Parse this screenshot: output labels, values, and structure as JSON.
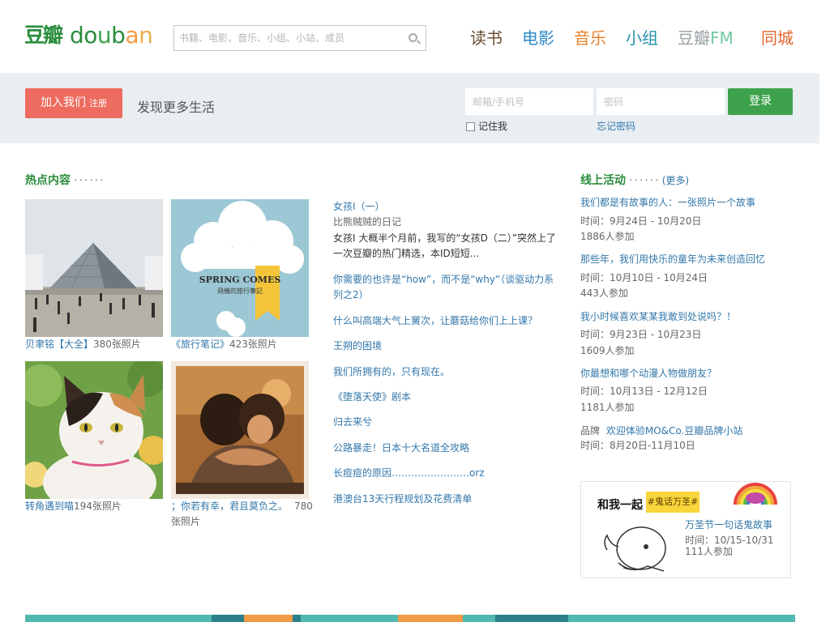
{
  "header": {
    "logo_han": "豆瓣",
    "logo_letters": [
      {
        "ch": "d",
        "color": "#2a8d3c"
      },
      {
        "ch": "o",
        "color": "#2a8d3c"
      },
      {
        "ch": "u",
        "color": "#3da24b"
      },
      {
        "ch": "b",
        "color": "#2a8d3c"
      },
      {
        "ch": "a",
        "color": "#f29b45"
      },
      {
        "ch": "n",
        "color": "#e8b04a"
      }
    ],
    "search_placeholder": "书籍、电影、音乐、小组、小站、成员",
    "channels": [
      {
        "label": "读书",
        "color": "#6a4a2c"
      },
      {
        "label": "电影",
        "color": "#2f8acb"
      },
      {
        "label": "音乐",
        "color": "#e8822e"
      },
      {
        "label": "小组",
        "color": "#2591a8"
      },
      {
        "label_a": "豆瓣",
        "label_b": "FM",
        "color": "#98a0a3",
        "color_b": "#6fcba3"
      },
      {
        "label": "同城",
        "color": "#e2642d"
      }
    ]
  },
  "band": {
    "join_label": "加入我们",
    "join_sub": "注册",
    "slogan": "发现更多生活",
    "email_placeholder": "邮箱/手机号",
    "password_placeholder": "密码",
    "login_label": "登录",
    "remember_label": "记住我",
    "forgot_label": "忘记密码"
  },
  "hot": {
    "title": "热点内容",
    "dots": "······",
    "photos": [
      {
        "title": "贝聿铭【大全】",
        "count": "380张照片"
      },
      {
        "title": "《旅行笔记》",
        "count": "423张照片"
      },
      {
        "title": "转角遇到喵",
        "count": "194张照片"
      },
      {
        "title": "；你若有幸，君且莫负之。",
        "count": "780张照片"
      }
    ],
    "poster_text": "SPRING COMES",
    "poster_sub": "飛機的旅行筆記",
    "articles": [
      {
        "title": "女孩I（一）",
        "sub": "比熊贼贼的日记",
        "desc": "女孩I 大概半个月前，我写的“女孩D（二）”突然上了一次豆瓣的热门精选，本ID短短..."
      },
      {
        "title": "你需要的也许是“how”，而不是“why”（谈驱动力系列之2）"
      },
      {
        "title": "什么叫高端大气上黉次，让蘑菇给你们上上课？"
      },
      {
        "title": "王朔的困境"
      },
      {
        "title": "我们所拥有的，只有现在。"
      },
      {
        "title": "《堕落天使》剧本"
      },
      {
        "title": "归去来兮"
      },
      {
        "title": "公路暴走！日本十大名道全攻略"
      },
      {
        "title": "长痘痘的原因……………………orz"
      },
      {
        "title": "港澳台13天行程规划及花费清单"
      }
    ]
  },
  "events": {
    "title": "线上活动",
    "dots": "······",
    "more": "(更多)",
    "items": [
      {
        "title": "我们都是有故事的人：一张照片一个故事",
        "time": "时间：9月24日 - 10月20日",
        "count": "1886人参加"
      },
      {
        "title": "那些年，我们用快乐的童年为未来创造回忆",
        "time": "时间：10月10日 - 10月24日",
        "count": "443人参加"
      },
      {
        "title": "我小时候喜欢某某我敢到处说吗？！",
        "time": "时间：9月23日 - 10月23日",
        "count": "1609人参加"
      },
      {
        "title": "你最想和哪个动漫人物做朋友？",
        "time": "时间：10月13日 - 12月12日",
        "count": "1181人参加"
      }
    ],
    "brand_label": "品牌",
    "brand_title": "欢迎体验MO&Co.豆瓣品牌小站",
    "brand_time": "时间：8月20日-11月10日"
  },
  "ad": {
    "headline": "和我一起",
    "tag": "#鬼话万圣#",
    "title": "万圣节一句话鬼故事",
    "time": "时间：10/15-10/31",
    "count": "111人参加"
  },
  "colors": {
    "green": "#2a8d3c",
    "link": "#3377aa",
    "join": "#ee6b5f",
    "login": "#3da24b",
    "band": "#e9eef2"
  }
}
